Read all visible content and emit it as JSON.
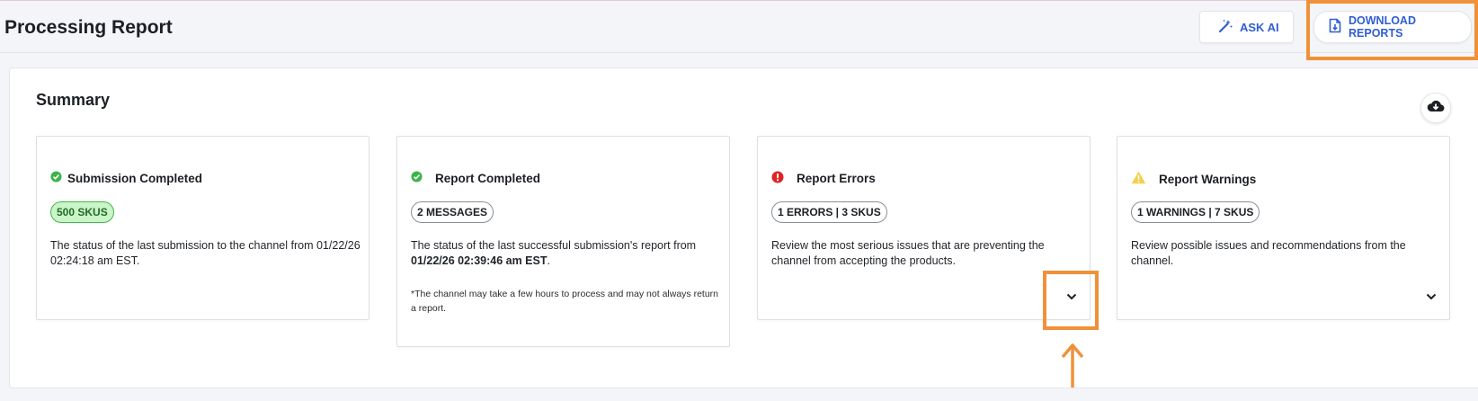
{
  "header": {
    "title": "Processing Report",
    "ask_ai_label": "ASK AI",
    "download_label": "DOWNLOAD REPORTS"
  },
  "summary": {
    "title": "Summary",
    "cards": [
      {
        "title": "Submission Completed",
        "status": "success",
        "badge": "500 SKUS",
        "desc": "The status of the last submission to the channel from 01/22/26 02:24:18 am EST."
      },
      {
        "title": "Report Completed",
        "status": "success",
        "badge": "2 MESSAGES",
        "desc_prefix": "The status of the last successful submission's report from",
        "desc_bold": "01/22/26 02:39:46 am EST",
        "desc_suffix": ".",
        "note": "*The channel may take a few hours to process and may not always return a report."
      },
      {
        "title": "Report Errors",
        "status": "error",
        "badge": "1 ERRORS | 3 SKUS",
        "desc": "Review the most serious issues that are preventing the channel from accepting the products."
      },
      {
        "title": "Report Warnings",
        "status": "warning",
        "badge": "1 WARNINGS | 7 SKUS",
        "desc": "Review possible issues and recommendations from the channel."
      }
    ]
  },
  "icons": {
    "ask_ai": "magic-wand-icon",
    "download": "file-download-icon",
    "cloud": "cloud-download-icon",
    "success": "check-circle-icon",
    "error": "exclamation-circle-icon",
    "warning": "warning-triangle-icon",
    "expand": "chevron-down-icon"
  },
  "colors": {
    "accent": "#2f5fd0",
    "success": "#3bb54a",
    "error": "#e02424",
    "warning": "#f2d14a",
    "highlight": "#f0913a"
  }
}
